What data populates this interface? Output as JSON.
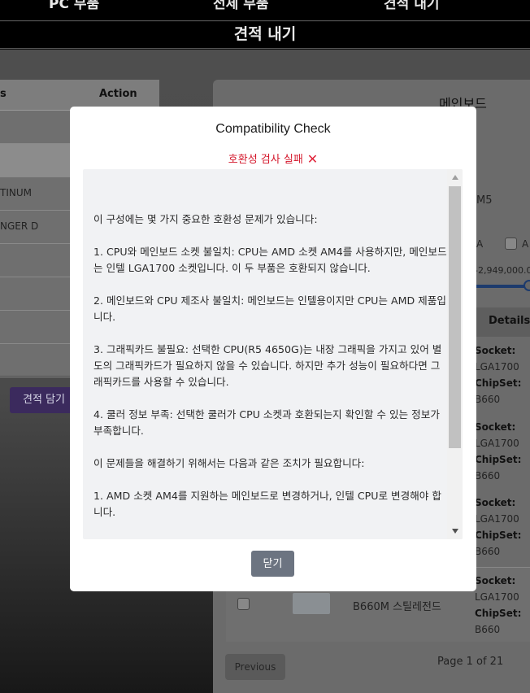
{
  "topnav": {
    "items": [
      "PC 부품",
      "전체 부품",
      "견적 내기"
    ]
  },
  "subnav": {
    "title": "견적 내기"
  },
  "left_panel": {
    "headers": [
      "s",
      "Action"
    ],
    "rows": [
      "",
      "",
      "TINUM",
      "NGER D",
      "",
      "",
      "",
      ""
    ],
    "add_button": "견적 담기"
  },
  "right_panel": {
    "title": "메인보드",
    "socket_fragment": "M5",
    "check_labels": [
      "A",
      "A"
    ],
    "price_range": "-2,949,000.0",
    "details_header": "Details",
    "specs": [
      {
        "socket_label": "Socket:",
        "socket": "LGA1700",
        "chipset_label": "ChipSet:",
        "chipset": "B660"
      },
      {
        "socket_label": "Socket:",
        "socket": "LGA1700",
        "chipset_label": "ChipSet:",
        "chipset": "B660"
      },
      {
        "socket_label": "Socket:",
        "socket": "LGA1700",
        "chipset_label": "ChipSet:",
        "chipset": "B660"
      },
      {
        "socket_label": "Socket:",
        "socket": "LGA1700",
        "chipset_label": "ChipSet:",
        "chipset": "B660"
      }
    ],
    "last_row_name": "B660M 스틸레전드",
    "prev_button": "Previous",
    "page_info": "Page 1 of 21"
  },
  "modal": {
    "title": "Compatibility Check",
    "status": "호환성 검사 실패",
    "status_icon": "cross-mark-icon",
    "status_color": "#d4182c",
    "paragraphs": [
      "이 구성에는 몇 가지 중요한 호환성 문제가 있습니다:",
      "1. CPU와 메인보드 소켓 불일치: CPU는 AMD 소켓 AM4를 사용하지만, 메인보드는 인텔 LGA1700 소켓입니다. 이 두 부품은 호환되지 않습니다.",
      "2. 메인보드와 CPU 제조사 불일치: 메인보드는 인텔용이지만 CPU는 AMD 제품입니다.",
      "3. 그래픽카드 불필요: 선택한 CPU(R5 4650G)는 내장 그래픽을 가지고 있어 별도의 그래픽카드가 필요하지 않을 수 있습니다. 하지만 추가 성능이 필요하다면 그래픽카드를 사용할 수 있습니다.",
      "4. 쿨러 정보 부족: 선택한 쿨러가 CPU 소켓과 호환되는지 확인할 수 있는 정보가 부족합니다.",
      "이 문제들을 해결하기 위해서는 다음과 같은 조치가 필요합니다:",
      "1. AMD 소켓 AM4를 지원하는 메인보드로 변경하거나, 인텔 CPU로 변경해야 합니다."
    ],
    "close_button": "닫기"
  }
}
